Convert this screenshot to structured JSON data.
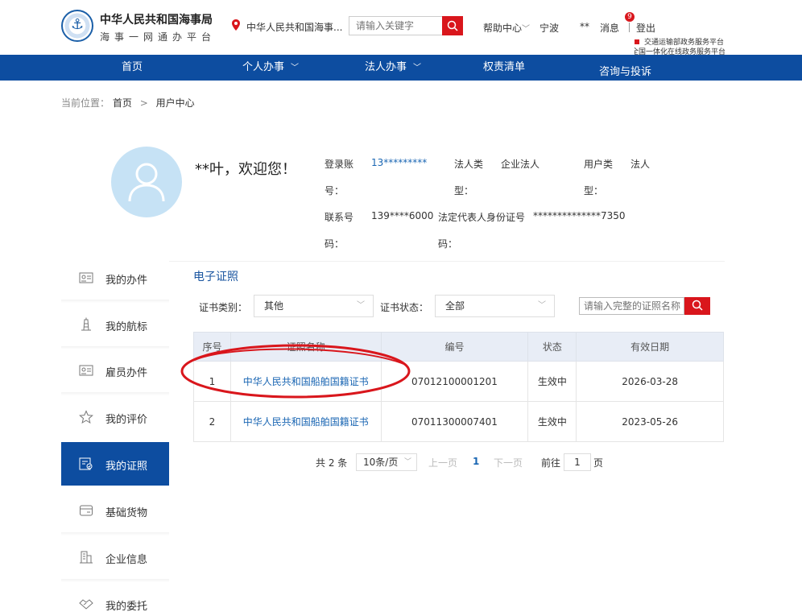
{
  "header": {
    "brand_title": "中华人民共和国海事局",
    "brand_sub": "海事一网通办平台",
    "location": "中华人民共和国海事...",
    "search_placeholder": "请输入关键字",
    "help": "帮助中心",
    "city": "宁波",
    "user": "**",
    "messages": "消息",
    "message_count": "9",
    "logout": "登出",
    "platform_line1": "交通运输部政务服务平台",
    "platform_line2": "全国一体化在线政务服务平台"
  },
  "nav": {
    "home": "首页",
    "personal": "个人办事",
    "legal": "法人办事",
    "rights": "权责清单",
    "consult": "咨询与投诉"
  },
  "breadcrumb": {
    "prefix": "当前位置：",
    "home": "首页",
    "current": "用户中心"
  },
  "profile": {
    "welcome": "**叶，欢迎您！",
    "account_label_1": "登录账",
    "account_label_2": "号：",
    "account_value": "13*********",
    "legal_type_label_1": "法人类",
    "legal_type_label_2": "型：",
    "legal_type_value": "企业法人",
    "user_type_label_1": "用户类",
    "user_type_label_2": "型：",
    "user_type_value": "法人",
    "phone_label_1": "联系号",
    "phone_label_2": "码：",
    "phone_value": "139****6000",
    "id_label_1": "法定代表人身份证号",
    "id_label_2": "码：",
    "id_value": "**************7350"
  },
  "sidebar": {
    "items": [
      {
        "label": "我的办件",
        "icon": "id-card-icon"
      },
      {
        "label": "我的航标",
        "icon": "lighthouse-icon"
      },
      {
        "label": "雇员办件",
        "icon": "id-card-icon"
      },
      {
        "label": "我的评价",
        "icon": "star-icon"
      },
      {
        "label": "我的证照",
        "icon": "certificate-icon"
      },
      {
        "label": "基础货物",
        "icon": "box-icon"
      },
      {
        "label": "企业信息",
        "icon": "building-icon"
      },
      {
        "label": "我的委托",
        "icon": "handshake-icon"
      }
    ],
    "active_index": 4
  },
  "certs": {
    "title": "电子证照",
    "type_label": "证书类别：",
    "type_value": "其他",
    "status_label": "证书状态：",
    "status_value": "全部",
    "search_placeholder": "请输入完整的证照名称",
    "columns": [
      "序号",
      "证照名称",
      "编号",
      "状态",
      "有效日期"
    ],
    "rows": [
      {
        "no": "1",
        "name": "中华人民共和国船舶国籍证书",
        "code": "07012100001201",
        "status": "生效中",
        "date": "2026-03-28"
      },
      {
        "no": "2",
        "name": "中华人民共和国船舶国籍证书",
        "code": "07011300007401",
        "status": "生效中",
        "date": "2023-05-26"
      }
    ]
  },
  "pagination": {
    "total": "共 2 条",
    "page_size": "10条/页",
    "prev": "上一页",
    "current": "1",
    "next": "下一页",
    "goto": "前往",
    "goto_value": "1",
    "page_unit": "页"
  },
  "colors": {
    "nav_blue": "#0d4da0",
    "accent_red": "#d9161c",
    "link_blue": "#1a66b3",
    "annotation_red": "#d9161c"
  }
}
